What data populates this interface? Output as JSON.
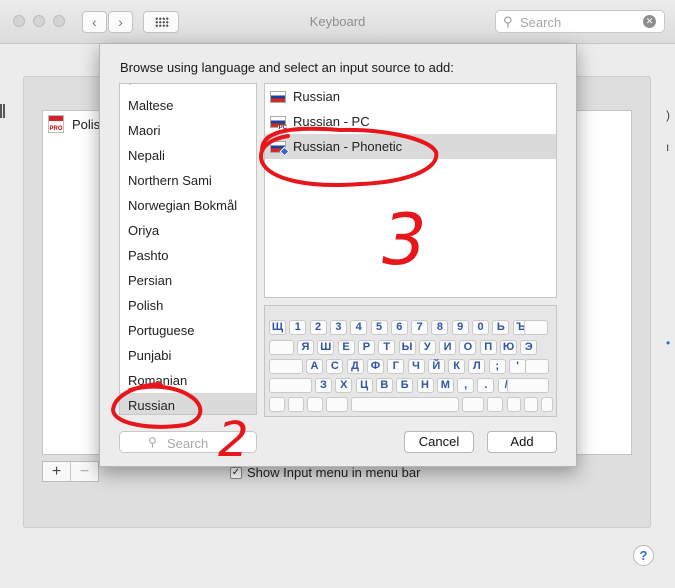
{
  "window": {
    "title": "Keyboard",
    "search_placeholder": "Search",
    "back_icon": "chevron-left-icon",
    "forward_icon": "chevron-right-icon"
  },
  "background": {
    "list_item": "Polis",
    "show_input_menu_label": "Show Input menu in menu bar",
    "help_label": "?"
  },
  "dialog": {
    "prompt": "Browse using language and select an input source to add:",
    "languages": [
      "Maltese",
      "Maori",
      "Nepali",
      "Northern Sami",
      "Norwegian Bokmål",
      "Oriya",
      "Pashto",
      "Persian",
      "Polish",
      "Portuguese",
      "Punjabi",
      "Romanian",
      "Russian"
    ],
    "selected_language": "Russian",
    "input_sources": [
      {
        "label": "Russian",
        "badge": ""
      },
      {
        "label": "Russian - PC",
        "badge": "PC"
      },
      {
        "label": "Russian - Phonetic",
        "badge": "diamond"
      }
    ],
    "selected_source": "Russian - Phonetic",
    "keyboard_rows": [
      [
        "Щ",
        "1",
        "2",
        "3",
        "4",
        "5",
        "6",
        "7",
        "8",
        "9",
        "0",
        "Ь",
        "Ъ"
      ],
      [
        "Я",
        "Ш",
        "Е",
        "Р",
        "Т",
        "Ы",
        "У",
        "И",
        "О",
        "П",
        "Ю",
        "Э"
      ],
      [
        "А",
        "С",
        "Д",
        "Ф",
        "Г",
        "Ч",
        "Й",
        "К",
        "Л",
        ";",
        "'"
      ],
      [
        "З",
        "Х",
        "Ц",
        "В",
        "Б",
        "Н",
        "М",
        ",",
        ".",
        "/"
      ]
    ],
    "search_placeholder": "Search",
    "cancel_label": "Cancel",
    "add_label": "Add"
  },
  "annotations": {
    "number_2": "2",
    "number_3": "3",
    "color": "#e8161b"
  }
}
